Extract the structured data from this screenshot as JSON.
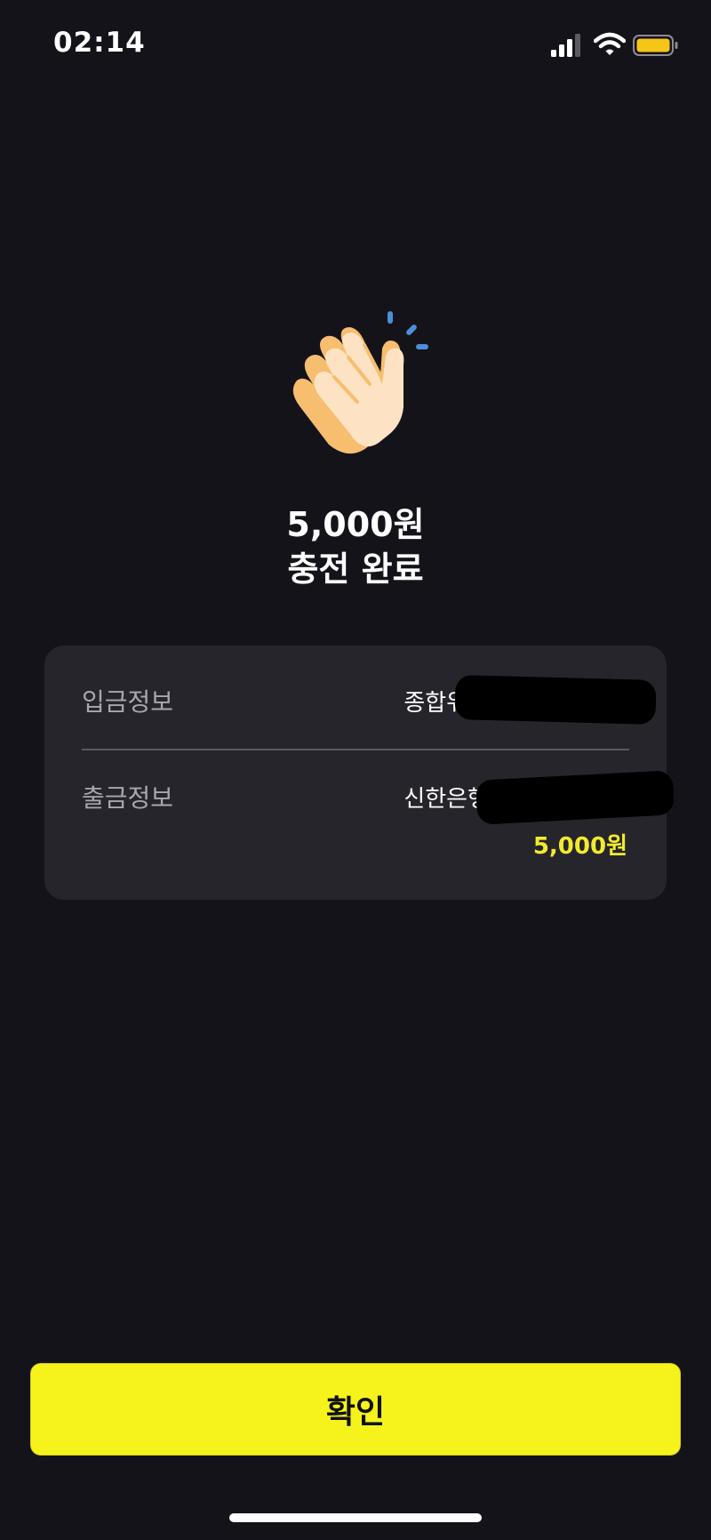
{
  "status_bar": {
    "time": "02:14",
    "icons": [
      "signal-icon",
      "wifi-icon",
      "battery-icon"
    ],
    "battery_color": "#f5c518"
  },
  "hero": {
    "icon": "clapping-hands-icon",
    "amount_text": "5,000원",
    "status_text": "충전 완료"
  },
  "info_card": {
    "deposit": {
      "label": "입금정보",
      "value": "종합위탁"
    },
    "withdraw": {
      "label": "출금정보",
      "value": "신한은행",
      "amount": "5,000원"
    }
  },
  "confirm_button": {
    "label": "확인",
    "color": "#f6f31c"
  },
  "colors": {
    "background": "#15131a",
    "card": "#27252c",
    "accent": "#f1eb2c"
  }
}
